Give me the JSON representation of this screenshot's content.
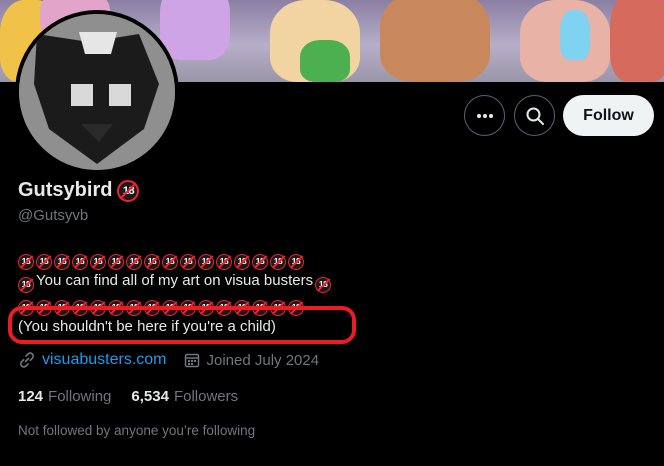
{
  "profile": {
    "display_name": "Gutsybird",
    "handle": "@Gutsyvb",
    "badge_text": "18",
    "bio_line_4": "(You shouldn't be here if you're a child)",
    "bio_line_2_text": "You can find all of my art on visua busters",
    "website": "visuabusters.com",
    "joined": "Joined July 2024",
    "following_count": "124",
    "following_label": "Following",
    "followers_count": "6,534",
    "followers_label": "Followers",
    "not_followed_text": "Not followed by anyone you’re following"
  },
  "actions": {
    "more_icon": "more-icon",
    "search_icon": "search-icon",
    "follow_label": "Follow"
  },
  "colors": {
    "background": "#000000",
    "link": "#1d9bf0",
    "muted": "#71767b",
    "annotation_red": "#ec1c24"
  }
}
